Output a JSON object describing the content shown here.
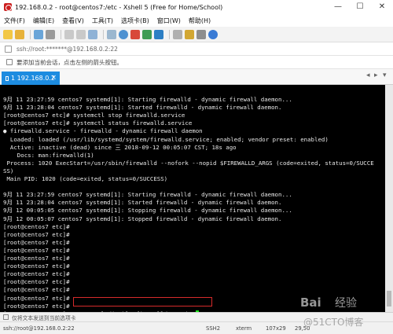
{
  "window": {
    "title": "192.168.0.2 - root@centos7:/etc - Xshell 5 (Free for Home/School)",
    "controls": [
      "—",
      "☐",
      "✕"
    ]
  },
  "menu": {
    "items": [
      "文件(F)",
      "编辑(E)",
      "查看(V)",
      "工具(T)",
      "选项卡(B)",
      "窗口(W)",
      "帮助(H)"
    ]
  },
  "address": {
    "text": "ssh://root:*******@192.168.0.2:22"
  },
  "info": {
    "text": "要添加当前会话，点击左侧的箭头按钮。"
  },
  "tabs": [
    {
      "label": "1 192.168.0.2"
    }
  ],
  "terminal": {
    "lines": [
      "9月 11 23:27:59 centos7 systemd[1]: Starting firewalld - dynamic firewall daemon...",
      "9月 11 23:28:04 centos7 systemd[1]: Started firewalld - dynamic firewall daemon.",
      "[root@centos7 etc]# systemctl stop firewalld.service",
      "[root@centos7 etc]# systemctl status firewalld.service",
      "● firewalld.service - firewalld - dynamic firewall daemon",
      "  Loaded: loaded (/usr/lib/systemd/system/firewalld.service; enabled; vendor preset: enabled)",
      "  Active: inactive (dead) since 三 2018-09-12 00:05:07 CST; 18s ago",
      "    Docs: man:firewalld(1)",
      " Process: 1020 ExecStart=/usr/sbin/firewalld --nofork --nopid $FIREWALLD_ARGS (code=exited, status=0/SUCCE",
      "SS)",
      " Main PID: 1020 (code=exited, status=0/SUCCESS)",
      "",
      "9月 11 23:27:59 centos7 systemd[1]: Starting firewalld - dynamic firewall daemon...",
      "9月 11 23:28:04 centos7 systemd[1]: Started firewalld - dynamic firewall daemon.",
      "9月 12 00:05:05 centos7 systemd[1]: Stopping firewalld - dynamic firewall daemon...",
      "9月 12 00:05:07 centos7 systemd[1]: Stopped firewalld - dynamic firewall daemon.",
      "[root@centos7 etc]#",
      "[root@centos7 etc]#",
      "[root@centos7 etc]#",
      "[root@centos7 etc]#",
      "[root@centos7 etc]#",
      "[root@centos7 etc]#",
      "[root@centos7 etc]#",
      "[root@centos7 etc]#",
      "[root@centos7 etc]#",
      "[root@centos7 etc]#",
      "[root@centos7 etc]#",
      "[root@centos7 etc]# systemctl disable firewalld.service"
    ],
    "colors": {
      "background": "#000000",
      "text": "#e8e8e8",
      "cursor": "#1ee61e",
      "highlight_box": "#d62b2b"
    }
  },
  "sendbar": {
    "text": "仅将文本发送到当前选项卡"
  },
  "status": {
    "connection": "ssh://root@192.168.0.2:22",
    "protocol": "SSH2",
    "terminal_type": "xterm",
    "size": "107x29",
    "cursor_pos": "29,50"
  },
  "watermark": {
    "text1": "Bai",
    "text2": "经验",
    "text3": "@51CTO博客"
  },
  "colors": {
    "tab_active": "#1d8ce0",
    "title_icon": "#cc1f1f"
  }
}
